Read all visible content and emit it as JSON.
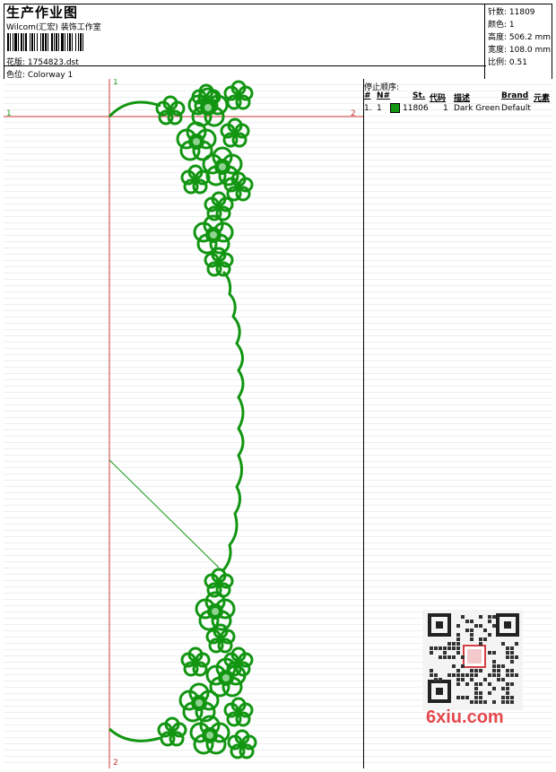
{
  "header": {
    "title": "生产作业图",
    "subtitle": "Wilcom(汇宏) 装饰工作室",
    "design_label": "花版: 1754823.dst",
    "colorway_label": "色位: Colorway 1"
  },
  "info": {
    "stitches": "针数: 11809",
    "colors": "颜色: 1",
    "height": "高度: 506.2 mm",
    "width": "宽度: 108.0 mm",
    "scale": "比例: 0.51"
  },
  "stop_sequence": {
    "title": "停止顺序:",
    "columns": [
      "#",
      "N#",
      "St.",
      "代码",
      "描述",
      "Brand",
      "元素"
    ],
    "rows": [
      {
        "index": "1.",
        "needle": "1",
        "stitches": "11806",
        "code": "1",
        "description": "Dark Green",
        "brand": "Default",
        "color": "#129612"
      }
    ]
  },
  "axis": {
    "top_left": "1",
    "top": "1",
    "right": "2",
    "bottom": "2"
  },
  "colors": {
    "thread": "#129612",
    "guide": "#d23a3a"
  },
  "watermark": {
    "text": "6xiu.com"
  }
}
